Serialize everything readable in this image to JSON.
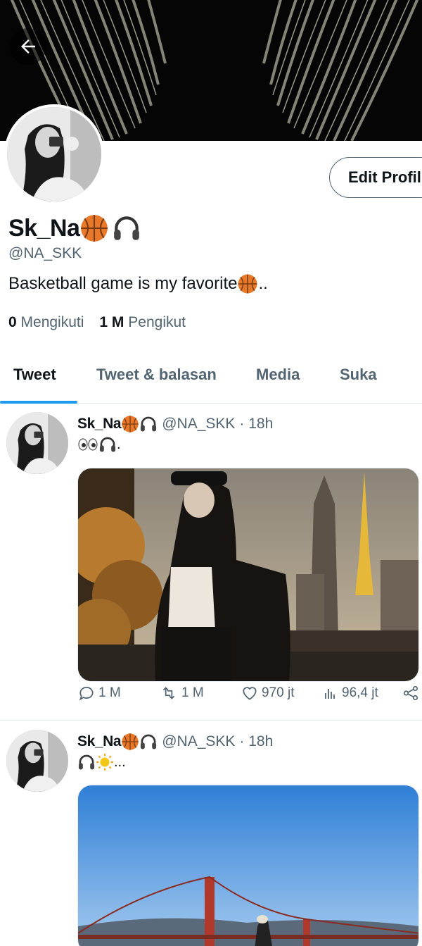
{
  "header": {
    "back_icon": "arrow-left-icon",
    "edit_profile_label": "Edit Profil"
  },
  "profile": {
    "name": "Sk_Na",
    "name_emojis": [
      "basketball-icon",
      "headphones-icon"
    ],
    "handle": "@NA_SKK",
    "bio": "Basketball game is my favorite",
    "bio_suffix": "..",
    "following_count": "0",
    "following_label": "Mengikuti",
    "followers_count": "1 M",
    "followers_label": "Pengikut"
  },
  "tabs": [
    {
      "label": "Tweet",
      "active": true
    },
    {
      "label": "Tweet & balasan",
      "active": false
    },
    {
      "label": "Media",
      "active": false
    },
    {
      "label": "Suka",
      "active": false
    }
  ],
  "tweets": [
    {
      "name": "Sk_Na",
      "handle": "@NA_SKK",
      "time": "· 18h",
      "text_suffix": ".",
      "text_icons": [
        "eyes-icon",
        "headphones-icon"
      ],
      "replies": "1 M",
      "retweets": "1 M",
      "likes": "970 jt",
      "views": "96,4 jt"
    },
    {
      "name": "Sk_Na",
      "handle": "@NA_SKK",
      "time": "· 18h",
      "text_suffix": "...",
      "text_icons": [
        "headphones-icon",
        "sun-icon"
      ]
    }
  ],
  "colors": {
    "accent": "#1d9bf0",
    "muted_text": "#536471",
    "primary_text": "#0f1419",
    "basketball": "#e8792b"
  }
}
